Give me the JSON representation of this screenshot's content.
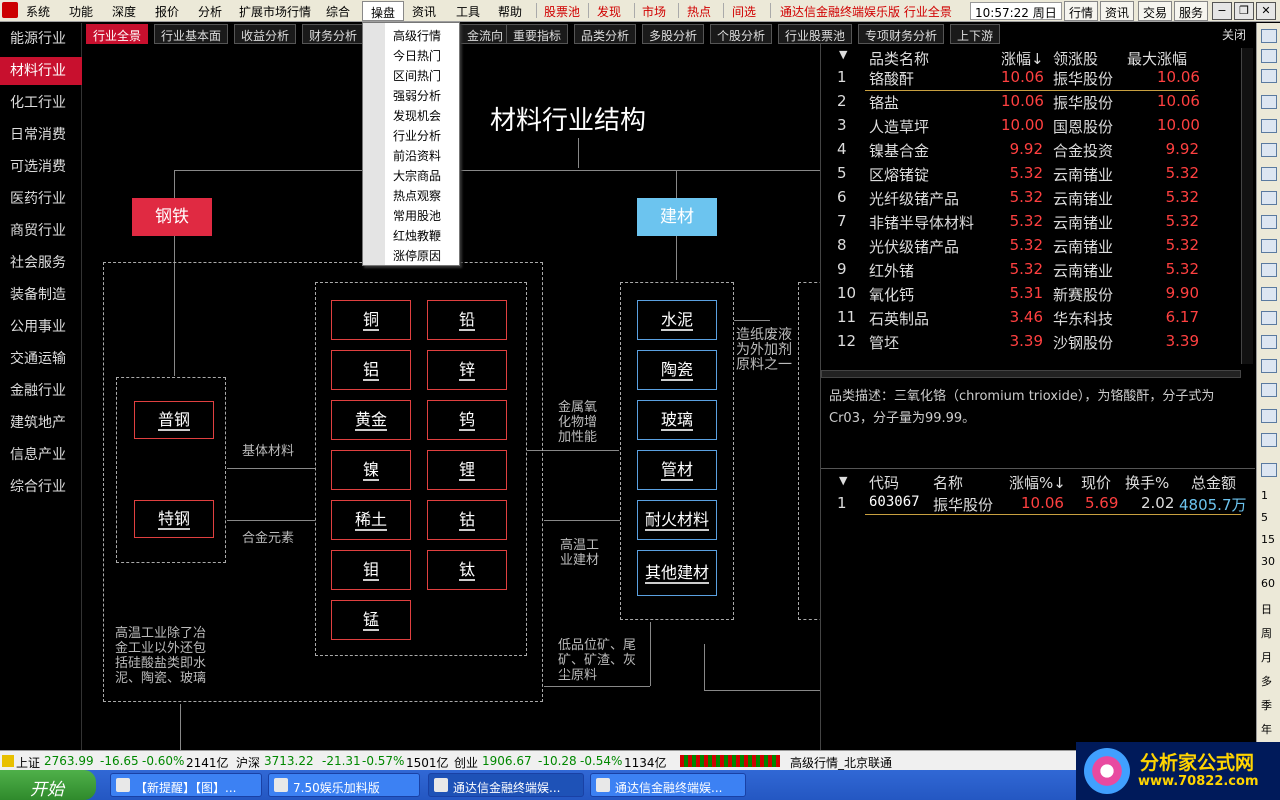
{
  "menu": {
    "items": [
      "系统",
      "功能",
      "深度",
      "报价",
      "分析",
      "扩展市场行情",
      "综合",
      "操盘",
      "资讯",
      "工具",
      "帮助"
    ],
    "red_items": [
      "股票池",
      "发现",
      "市场",
      "热点",
      "间选"
    ],
    "app_title": "通达信金融终端娱乐版 行业全景",
    "clock": "10:57:22 周日",
    "buttons": [
      "行情",
      "资讯",
      "交易",
      "服务"
    ]
  },
  "sidebar": {
    "items": [
      "能源行业",
      "材料行业",
      "化工行业",
      "日常消费",
      "可选消费",
      "医药行业",
      "商贸行业",
      "社会服务",
      "装备制造",
      "公用事业",
      "交通运输",
      "金融行业",
      "建筑地产",
      "信息产业",
      "综合行业"
    ],
    "active_index": 1
  },
  "tabs": {
    "items": [
      "行业全景",
      "行业基本面",
      "收益分析",
      "财务分析",
      "",
      "金流向",
      "重要指标",
      "品类分析",
      "多股分析",
      "个股分析",
      "行业股票池",
      "专项财务分析",
      "上下游"
    ],
    "close_label": "关闭"
  },
  "dropdown": {
    "items": [
      "高级行情",
      "今日热门",
      "区间热门",
      "强弱分析",
      "发现机会",
      "行业分析",
      "前沿资料",
      "大宗商品",
      "热点观察",
      "常用股池",
      "红烛教鞭",
      "涨停原因"
    ]
  },
  "diagram": {
    "title": "材料行业结构",
    "cat_steel": "钢铁",
    "cat_building": "建材",
    "steel_types": [
      "普钢",
      "特钢"
    ],
    "metals_left": [
      "铜",
      "铝",
      "黄金",
      "镍",
      "稀土",
      "钼",
      "锰"
    ],
    "metals_right": [
      "铅",
      "锌",
      "钨",
      "锂",
      "钴",
      "钛"
    ],
    "building": [
      "水泥",
      "陶瓷",
      "玻璃",
      "管材",
      "耐火材料",
      "其他建材"
    ],
    "labels": {
      "base_material": "基体材料",
      "alloy": "合金元素",
      "oxide": "金属氧\n化物增\n加性能",
      "hightemp": "高温工\n业建材",
      "lowgrade": "低品位矿、尾\n矿、矿渣、灰\n尘原料",
      "paper": "造纸废液\n为外加剂\n原料之一",
      "note": "高温工业除了冶\n金工业以外还包\n括硅酸盐类即水\n泥、陶瓷、玻璃"
    }
  },
  "category_table": {
    "headers": [
      "品类名称",
      "涨幅↓",
      "领涨股",
      "最大涨幅"
    ],
    "rows": [
      {
        "i": "1",
        "name": "铬酸酐",
        "chg": "10.06",
        "lead": "振华股份",
        "max": "10.06"
      },
      {
        "i": "2",
        "name": "铬盐",
        "chg": "10.06",
        "lead": "振华股份",
        "max": "10.06"
      },
      {
        "i": "3",
        "name": "人造草坪",
        "chg": "10.00",
        "lead": "国恩股份",
        "max": "10.00"
      },
      {
        "i": "4",
        "name": "镍基合金",
        "chg": "9.92",
        "lead": "合金投资",
        "max": "9.92"
      },
      {
        "i": "5",
        "name": "区熔锗锭",
        "chg": "5.32",
        "lead": "云南锗业",
        "max": "5.32"
      },
      {
        "i": "6",
        "name": "光纤级锗产品",
        "chg": "5.32",
        "lead": "云南锗业",
        "max": "5.32"
      },
      {
        "i": "7",
        "name": "非锗半导体材料",
        "chg": "5.32",
        "lead": "云南锗业",
        "max": "5.32"
      },
      {
        "i": "8",
        "name": "光伏级锗产品",
        "chg": "5.32",
        "lead": "云南锗业",
        "max": "5.32"
      },
      {
        "i": "9",
        "name": "红外锗",
        "chg": "5.32",
        "lead": "云南锗业",
        "max": "5.32"
      },
      {
        "i": "10",
        "name": "氧化钙",
        "chg": "5.31",
        "lead": "新赛股份",
        "max": "9.90"
      },
      {
        "i": "11",
        "name": "石英制品",
        "chg": "3.46",
        "lead": "华东科技",
        "max": "6.17"
      },
      {
        "i": "12",
        "name": "管坯",
        "chg": "3.39",
        "lead": "沙钢股份",
        "max": "3.39"
      }
    ]
  },
  "description": "品类描述：三氧化铬（chromium trioxide），为铬酸酐，分子式为Cr03，分子量为99.99。",
  "stock_table": {
    "headers": [
      "代码",
      "名称",
      "涨幅%↓",
      "现价",
      "换手%",
      "总金额"
    ],
    "rows": [
      {
        "i": "1",
        "code": "603067",
        "name": "振华股份",
        "chg": "10.06",
        "price": "5.69",
        "turn": "2.02",
        "amt": "4805.7万"
      }
    ]
  },
  "right_toolbar": [
    "1",
    "5",
    "15",
    "30",
    "60",
    "日",
    "周",
    "月",
    "多",
    "季",
    "年"
  ],
  "status": {
    "sh_label": "上证",
    "sh_val": "2763.99",
    "sh_chg": "-16.65",
    "sh_pct": "-0.60%",
    "sh_amt": "2141亿",
    "hs_label": "沪深",
    "hs_val": "3713.22",
    "hs_chg": "-21.31",
    "hs_pct": "-0.57%",
    "hs_amt": "1501亿",
    "cy_label": "创业",
    "cy_val": "1906.67",
    "cy_chg": "-10.28",
    "cy_pct": "-0.54%",
    "cy_amt": "1134亿",
    "server": "高级行情_北京联通"
  },
  "taskbar": {
    "start": "开始",
    "tasks": [
      "【新提醒】【图】...",
      "7.50娱乐加料版",
      "通达信金融终端娱...",
      "通达信金融终端娱..."
    ]
  },
  "brand": {
    "name": "分析家公式网",
    "url": "www.70822.com"
  }
}
